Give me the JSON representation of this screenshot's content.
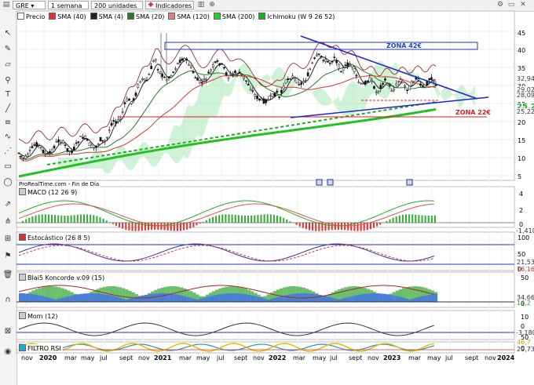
{
  "toolbar": {
    "symbol": "GRE",
    "period": "1 semana",
    "units": "200 unidades",
    "indicators": "Indicadores"
  },
  "legend": [
    {
      "label": "Precio",
      "color": "#ffffff"
    },
    {
      "label": "SMA (40)",
      "color": "#d33"
    },
    {
      "label": "SMA (4)",
      "color": "#222"
    },
    {
      "label": "SMA (20)",
      "color": "#2b7a2b"
    },
    {
      "label": "SMA (120)",
      "color": "#e08080"
    },
    {
      "label": "SMA (200)",
      "color": "#3c3"
    },
    {
      "label": "Ichimoku (W 9 26 52)",
      "color": "#2a2"
    }
  ],
  "source_label": "ProRealTime.com - Fin de Día",
  "panels": {
    "macd": "MACD (12 26 9)",
    "stoch": "Estocástico (26 8 5)",
    "koncorde": "Blai5 Koncorde v.09 (15)",
    "mom": "Mom (12)",
    "rsi": "FILTRO RSI"
  },
  "zones": {
    "upper": "ZONA 42€",
    "lower": "ZONA 22€"
  },
  "price_axis": [
    "45",
    "40",
    "35",
    "30",
    "25",
    "20",
    "15",
    "10",
    "5"
  ],
  "price_tags": [
    {
      "text": "32,946",
      "bg": "#ffffff",
      "fg": "#333"
    },
    {
      "text": "29,020",
      "bg": "#ffffff",
      "fg": "#333"
    },
    {
      "text": "28,090",
      "bg": "#ffffff",
      "fg": "#333"
    },
    {
      "text": "25,2",
      "bg": "#ffffff",
      "fg": "#2a2"
    },
    {
      "text": "25,220",
      "bg": "#ffffff",
      "fg": "#333"
    }
  ],
  "macd_axis": [
    "4",
    "2",
    "0"
  ],
  "macd_tag": "-1,410",
  "stoch_axis": [
    "100",
    "50",
    "0"
  ],
  "stoch_tags": [
    "21,536",
    "16,166"
  ],
  "konc_axis": [
    "50",
    "0"
  ],
  "konc_tags": [
    "34,666",
    "14,2"
  ],
  "mom_axis": [
    "10",
    "0"
  ],
  "mom_tag": "-3,180",
  "rsi_axis": [
    "50",
    "0"
  ],
  "rsi_tags": [
    "46,7",
    "20,734"
  ],
  "x_axis": [
    "nov",
    "2020",
    "mar",
    "may",
    "jul",
    "sept",
    "nov",
    "2021",
    "mar",
    "may",
    "jul",
    "sept",
    "nov",
    "2022",
    "mar",
    "may",
    "jul",
    "sept",
    "nov",
    "2023",
    "mar",
    "may",
    "jul",
    "sept",
    "nov",
    "2024"
  ],
  "colors": {
    "up": "#ffffff",
    "down": "#111111",
    "sma200": "#22c022",
    "trend": "#2222cc",
    "zone_red": "#cc2222"
  }
}
